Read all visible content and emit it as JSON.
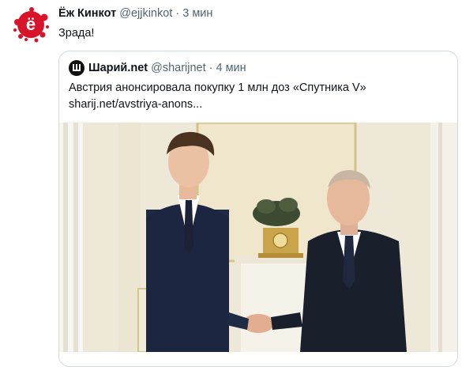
{
  "tweet": {
    "author_name": "Ёж Кинкот",
    "author_handle": "@ejjkinkot",
    "separator": "·",
    "time": "3 мин",
    "text": "Зрада!",
    "avatar_letter": "ё"
  },
  "quote": {
    "author_name": "Шарий.net",
    "author_handle": "@sharijnet",
    "separator": "·",
    "time": "4 мин",
    "headline": "Австрия анонсировала покупку 1 млн доз «Спутника V»",
    "link": "sharij.net/avstriya-anons..."
  },
  "colors": {
    "avatar_red": "#d7142a",
    "secondary_text": "#536471",
    "border": "#cfd9de"
  }
}
